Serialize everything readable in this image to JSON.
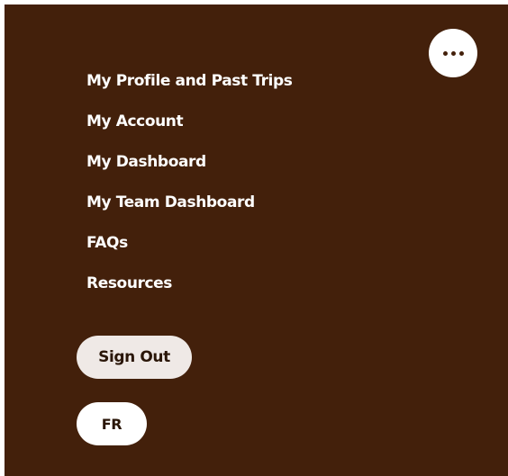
{
  "menu": {
    "more_button_icon": "more-horizontal-icon",
    "items": [
      {
        "label": "My Profile and Past Trips"
      },
      {
        "label": "My Account"
      },
      {
        "label": "My Dashboard"
      },
      {
        "label": "My Team Dashboard"
      },
      {
        "label": "FAQs"
      },
      {
        "label": "Resources"
      }
    ],
    "sign_out_label": "Sign Out",
    "language_label": "FR"
  },
  "colors": {
    "panel_background": "#43200b",
    "text": "#ffffff",
    "sign_out_background": "#efe9e6",
    "language_background": "#ffffff"
  }
}
